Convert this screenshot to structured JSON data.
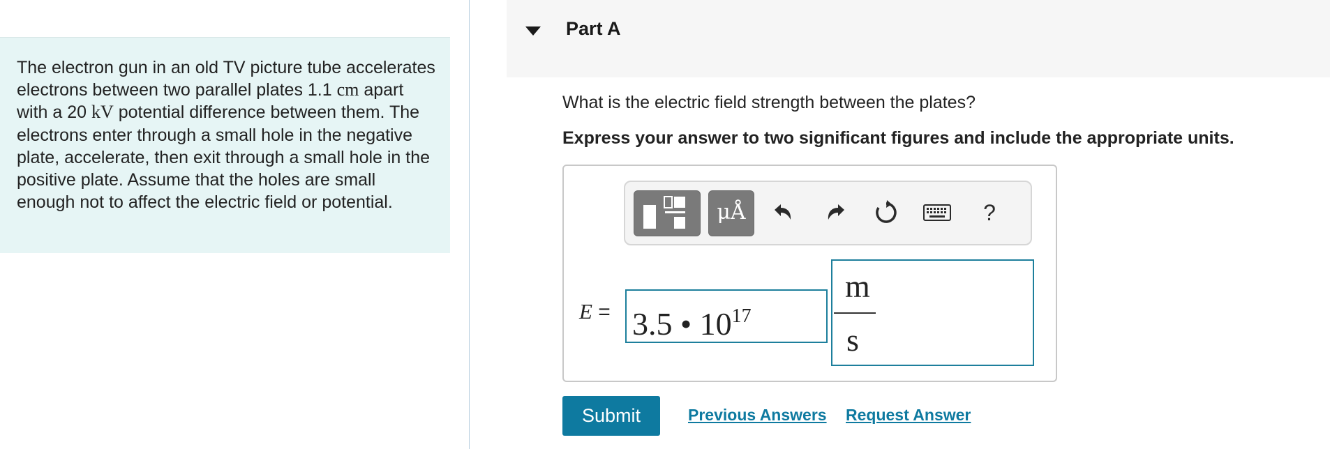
{
  "problem": {
    "text_1": "The electron gun in an old TV picture tube accelerates electrons between two parallel plates 1.1 ",
    "unit_distance": "cm",
    "text_2": " apart with a 20 ",
    "unit_voltage": "kV",
    "text_3": " potential difference between them. The electrons enter through a small hole in the negative plate, accelerate, then exit through a small hole in the positive plate. Assume that the holes are small enough not to affect the electric field or potential."
  },
  "part": {
    "title": "Part A",
    "question": "What is the electric field strength between the plates?",
    "instruction": "Express your answer to two significant figures and include the appropriate units."
  },
  "toolbar": {
    "units_label": "μÅ",
    "help_label": "?",
    "icons": [
      "templates-icon",
      "units-icon",
      "undo-icon",
      "redo-icon",
      "reset-icon",
      "keyboard-icon",
      "help-icon"
    ]
  },
  "answer": {
    "variable": "E",
    "equals": " =",
    "mantissa": "3.5 • 10",
    "exponent": "17",
    "unit_numerator": "m",
    "unit_denominator": "s"
  },
  "buttons": {
    "submit": "Submit",
    "previous_answers": "Previous Answers",
    "request_answer": "Request Answer"
  },
  "colors": {
    "accent": "#0e7aa0",
    "problem_bg": "#e6f5f5",
    "field_border": "#1d7f9c"
  }
}
